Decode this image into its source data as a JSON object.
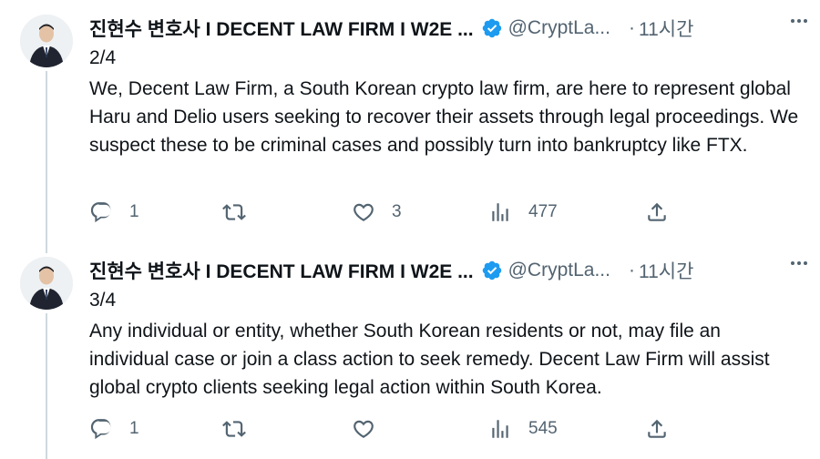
{
  "colors": {
    "text": "#0f1419",
    "secondary": "#536471",
    "verified": "#1d9bf0",
    "thread_line": "#cfd9de"
  },
  "tweets": [
    {
      "display_name": "진현수 변호사 I DECENT LAW FIRM I W2E ...",
      "handle": "@CryptLa...",
      "separator": "·",
      "time": "11시간",
      "counter": "2/4",
      "text": "We, Decent Law Firm, a South Korean crypto law firm, are here to represent global Haru and Delio users seeking to recover their assets through legal proceedings. We suspect these to be criminal cases and possibly turn into bankruptcy like FTX.",
      "replies": "1",
      "retweets": "",
      "likes": "3",
      "views": "477",
      "icons": [
        "verified-badge-icon",
        "more-icon",
        "reply-icon",
        "retweet-icon",
        "like-icon",
        "views-icon",
        "share-icon"
      ]
    },
    {
      "display_name": "진현수 변호사 I DECENT LAW FIRM I W2E ...",
      "handle": "@CryptLa...",
      "separator": "·",
      "time": "11시간",
      "counter": "3/4",
      "text": "Any individual or entity, whether South Korean residents or not, may file an individual case or join a class action to seek remedy. Decent Law Firm will assist global crypto clients seeking legal action within South Korea.",
      "replies": "1",
      "retweets": "",
      "likes": "",
      "views": "545",
      "icons": [
        "verified-badge-icon",
        "more-icon",
        "reply-icon",
        "retweet-icon",
        "like-icon",
        "views-icon",
        "share-icon"
      ]
    }
  ]
}
